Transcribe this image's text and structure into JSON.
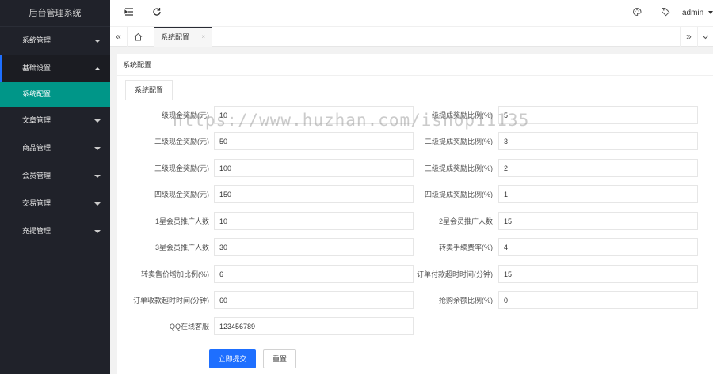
{
  "sidebar": {
    "brand": "后台管理系统",
    "menu": [
      {
        "label": "系统管理"
      },
      {
        "label": "基础设置",
        "open": true,
        "children": [
          {
            "label": "系统配置"
          }
        ]
      },
      {
        "label": "文章管理"
      },
      {
        "label": "商品管理"
      },
      {
        "label": "会员管理"
      },
      {
        "label": "交易管理"
      },
      {
        "label": "充提管理"
      }
    ]
  },
  "header": {
    "user": "admin",
    "icons": [
      "menu-fold-icon",
      "refresh-icon",
      "theme-icon",
      "tag-icon",
      "chevron-down-icon"
    ]
  },
  "tabbar": {
    "active_tab": "系统配置",
    "close_glyph": "×"
  },
  "card": {
    "title": "系统配置",
    "tab": "系统配置"
  },
  "form": {
    "rows": [
      {
        "left_label": "一级现金奖励(元)",
        "left_value": "10",
        "right_label": "一级提成奖励比例(%)",
        "right_value": "5"
      },
      {
        "left_label": "二级现金奖励(元)",
        "left_value": "50",
        "right_label": "二级提成奖励比例(%)",
        "right_value": "3"
      },
      {
        "left_label": "三级现金奖励(元)",
        "left_value": "100",
        "right_label": "三级提成奖励比例(%)",
        "right_value": "2"
      },
      {
        "left_label": "四级现金奖励(元)",
        "left_value": "150",
        "right_label": "四级提成奖励比例(%)",
        "right_value": "1"
      },
      {
        "left_label": "1星会员推广人数",
        "left_value": "10",
        "right_label": "2星会员推广人数",
        "right_value": "15"
      },
      {
        "left_label": "3星会员推广人数",
        "left_value": "30",
        "right_label": "转卖手续费率(%)",
        "right_value": "4"
      },
      {
        "left_label": "转卖售价增加比例(%)",
        "left_value": "6",
        "right_label": "订单付款超时时间(分钟)",
        "right_value": "15"
      },
      {
        "left_label": "订单收款超时时间(分钟)",
        "left_value": "60",
        "right_label": "抢购余额比例(%)",
        "right_value": "0"
      },
      {
        "left_label": "QQ在线客服",
        "left_value": "123456789"
      }
    ],
    "submit_label": "立即提交",
    "reset_label": "重置"
  },
  "watermark": "https://www.huzhan.com/ishop11135"
}
